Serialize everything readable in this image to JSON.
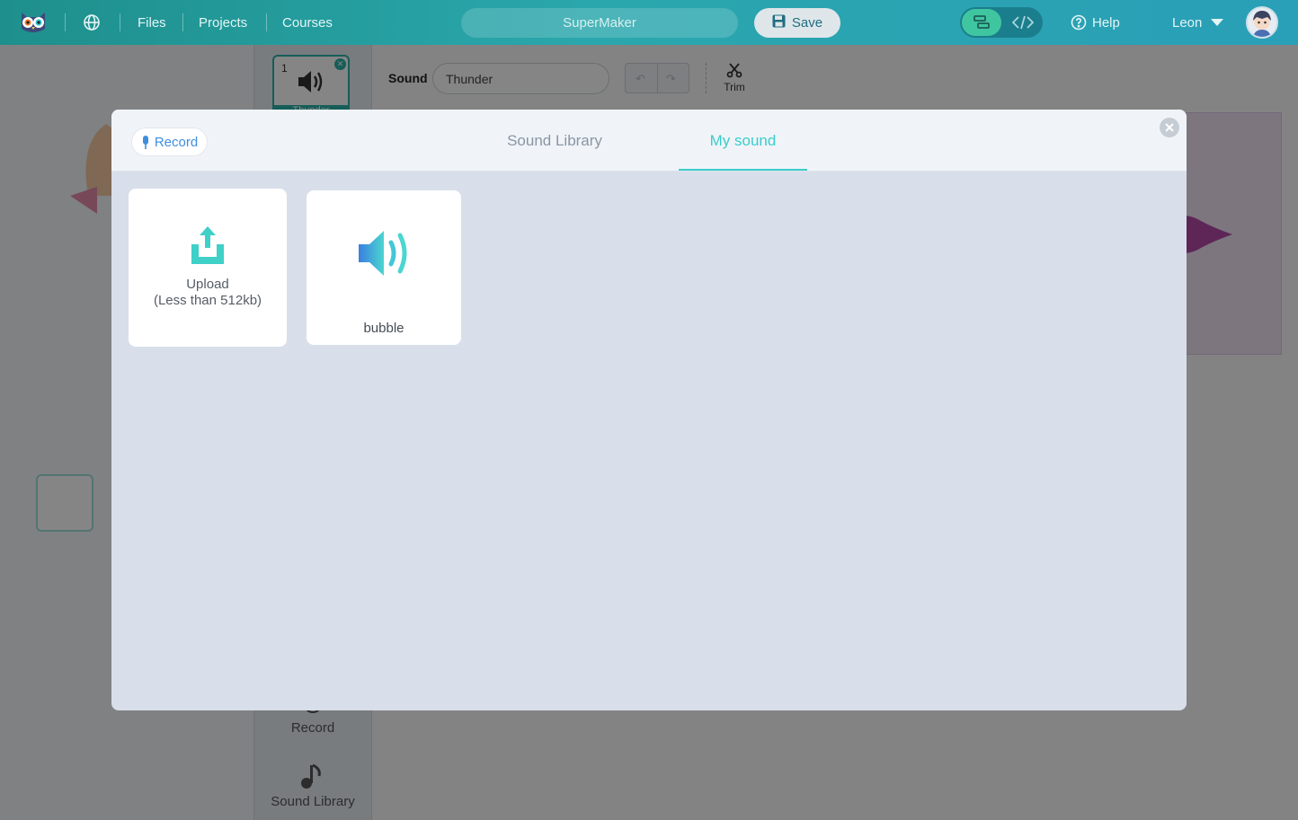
{
  "topbar": {
    "nav": [
      "Files",
      "Projects",
      "Courses"
    ],
    "project_name": "SuperMaker",
    "save_label": "Save",
    "help_label": "Help",
    "user_name": "Leon"
  },
  "background": {
    "sound_item": {
      "index": "1",
      "name": "Thunder"
    },
    "sound_field_label": "Sound",
    "sound_name_value": "Thunder",
    "trim_label": "Trim",
    "record_label": "Record",
    "library_label": "Sound Library"
  },
  "modal": {
    "record_label": "Record",
    "tabs": [
      {
        "label": "Sound Library",
        "active": false
      },
      {
        "label": "My sound",
        "active": true
      }
    ],
    "upload": {
      "title": "Upload",
      "hint": "(Less than 512kb)"
    },
    "sounds": [
      {
        "name": "bubble",
        "icon": "speaker-icon"
      }
    ]
  },
  "colors": {
    "topbar": "#2aa7ac",
    "accent": "#39cdcc",
    "record_blue": "#3f8fdd",
    "modal_body": "#d8dfea"
  }
}
